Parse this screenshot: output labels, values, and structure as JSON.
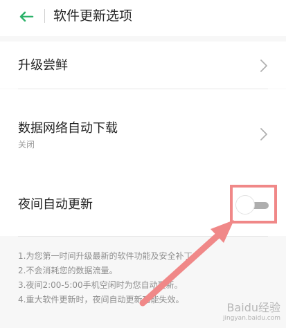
{
  "header": {
    "title": "软件更新选项",
    "back_icon": "back-arrow-icon",
    "accent_color": "#2db26a"
  },
  "rows": [
    {
      "label": "升级尝鲜",
      "chevron_icon": "chevron-right-icon"
    },
    {
      "label": "数据网络自动下载",
      "sublabel": "关闭",
      "chevron_icon": "chevron-right-icon"
    },
    {
      "label": "夜间自动更新",
      "toggle_state": "off"
    }
  ],
  "notes": [
    "1.为您第一时间升级最新的软件功能及安全补丁。",
    "2.不会消耗您的数据流量。",
    "3.夜间2:00-5:00手机空闲时为您自动更新。",
    "4.重大软件更新时，夜间自动更新功能失效。"
  ],
  "annotation": {
    "highlight_color": "#f08888",
    "arrow_color": "#f08888"
  },
  "watermark": {
    "brand": "Baidu经验",
    "url": "jingyan.baidu.com"
  }
}
